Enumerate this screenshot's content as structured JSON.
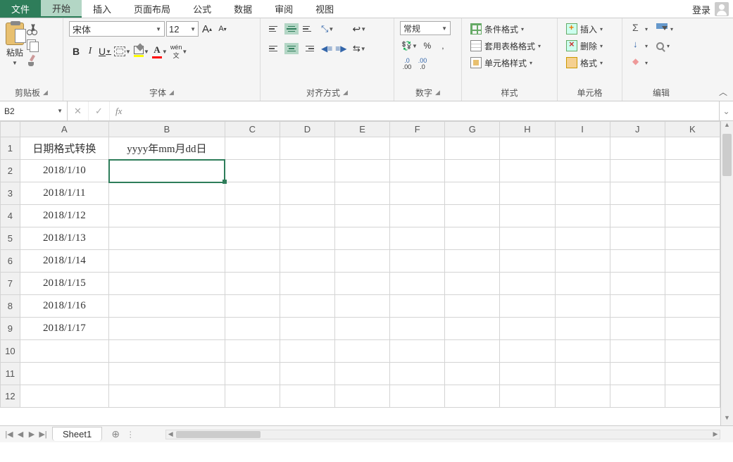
{
  "menu": {
    "file": "文件",
    "tabs": [
      "开始",
      "插入",
      "页面布局",
      "公式",
      "数据",
      "审阅",
      "视图"
    ],
    "active_index": 0,
    "login": "登录"
  },
  "ribbon": {
    "clipboard": {
      "label": "剪贴板",
      "paste": "粘贴"
    },
    "font": {
      "label": "字体",
      "name": "宋体",
      "size": "12",
      "grow": "A",
      "shrink": "A",
      "bold": "B",
      "italic": "I",
      "underline": "U",
      "phonetic": "wén",
      "font_color": "A"
    },
    "alignment": {
      "label": "对齐方式"
    },
    "number": {
      "label": "数字",
      "format": "常规",
      "currency": "",
      "percent": "%",
      "comma": ",",
      "inc_dec_icons": true,
      "dec1": ".0",
      "dec1b": ".00",
      "dec2": ".00",
      "dec2b": ".0"
    },
    "styles": {
      "label": "样式",
      "cond_format": "条件格式",
      "table_format": "套用表格格式",
      "cell_styles": "单元格样式"
    },
    "cells": {
      "label": "单元格",
      "insert": "插入",
      "delete": "删除",
      "format": "格式"
    },
    "editing": {
      "label": "编辑"
    }
  },
  "formula_bar": {
    "name_box": "B2",
    "cancel": "✕",
    "enter": "✓",
    "fx": "fx",
    "value": ""
  },
  "grid": {
    "columns": [
      "A",
      "B",
      "C",
      "D",
      "E",
      "F",
      "G",
      "H",
      "I",
      "J",
      "K"
    ],
    "col_widths": {
      "A": 128,
      "B": 168
    },
    "rows": [
      {
        "n": 1,
        "A": "日期格式转换",
        "B": "yyyy年mm月dd日"
      },
      {
        "n": 2,
        "A": "2018/1/10",
        "B": ""
      },
      {
        "n": 3,
        "A": "2018/1/11",
        "B": ""
      },
      {
        "n": 4,
        "A": "2018/1/12",
        "B": ""
      },
      {
        "n": 5,
        "A": "2018/1/13",
        "B": ""
      },
      {
        "n": 6,
        "A": "2018/1/14",
        "B": ""
      },
      {
        "n": 7,
        "A": "2018/1/15",
        "B": ""
      },
      {
        "n": 8,
        "A": "2018/1/16",
        "B": ""
      },
      {
        "n": 9,
        "A": "2018/1/17",
        "B": ""
      },
      {
        "n": 10,
        "A": "",
        "B": ""
      },
      {
        "n": 11,
        "A": "",
        "B": ""
      },
      {
        "n": 12,
        "A": "",
        "B": ""
      }
    ],
    "selected": {
      "row": 2,
      "col": "B"
    }
  },
  "sheets": {
    "active": "Sheet1"
  }
}
